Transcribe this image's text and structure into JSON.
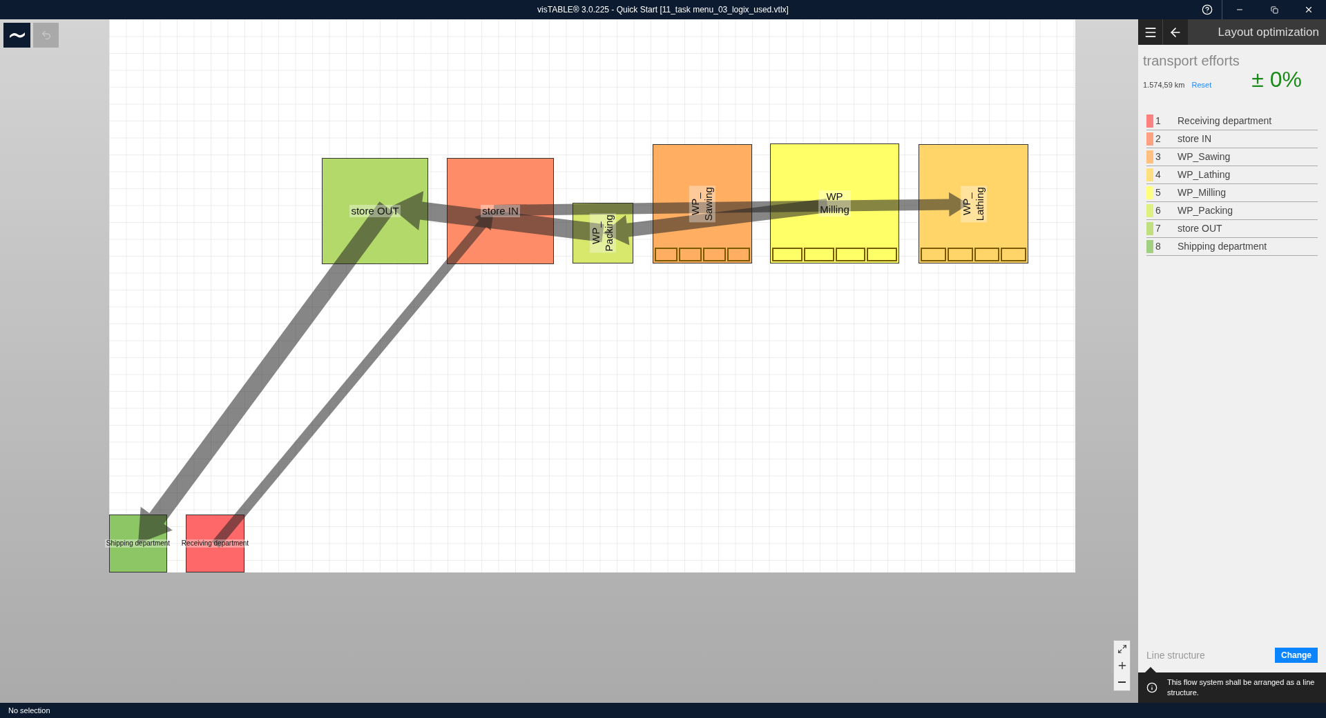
{
  "window": {
    "title": "visTABLE®  3.0.225 - Quick Start [11_task menu_03_logix_used.vtlx]"
  },
  "layout": {
    "areas": [
      {
        "label_lines": [
          "store OUT"
        ],
        "rotated": false,
        "color": "#b3d96a",
        "has_stations": false
      },
      {
        "label_lines": [
          "store IN"
        ],
        "rotated": false,
        "color": "#ff8c68",
        "has_stations": false
      },
      {
        "label_lines": [
          "WP_",
          "Packing"
        ],
        "rotated": true,
        "color": "#d8e86c",
        "has_stations": false
      },
      {
        "label_lines": [
          "WP_",
          "Sawing"
        ],
        "rotated": true,
        "color": "#ffae62",
        "has_stations": true
      },
      {
        "label_lines": [
          "WP",
          "Milling"
        ],
        "rotated": false,
        "color": "#ffff68",
        "has_stations": true
      },
      {
        "label_lines": [
          "WP_",
          "Lathing"
        ],
        "rotated": true,
        "color": "#ffd468",
        "has_stations": true
      },
      {
        "label_lines": [
          "Shipping department"
        ],
        "rotated": false,
        "color": "#8cc665",
        "has_stations": false
      },
      {
        "label_lines": [
          "Receiving department"
        ],
        "rotated": false,
        "color": "#ff6868",
        "has_stations": false
      }
    ]
  },
  "panel": {
    "title": "Layout optimization",
    "section": "transport efforts",
    "distance": "1.574,59 km",
    "reset": "Reset",
    "change": "± 0%",
    "legend": [
      {
        "number": "1",
        "name": "Receiving department",
        "color": "#ff8080"
      },
      {
        "number": "2",
        "name": "store IN",
        "color": "#ffa080"
      },
      {
        "number": "3",
        "name": "WP_Sawing",
        "color": "#ffc080"
      },
      {
        "number": "4",
        "name": "WP_Lathing",
        "color": "#ffe080"
      },
      {
        "number": "5",
        "name": "WP_Milling",
        "color": "#ffff80"
      },
      {
        "number": "6",
        "name": "WP_Packing",
        "color": "#e0f080"
      },
      {
        "number": "7",
        "name": "store OUT",
        "color": "#c0e080"
      },
      {
        "number": "8",
        "name": "Shipping department",
        "color": "#a0d080"
      }
    ],
    "structure_label": "Line structure",
    "change_button": "Change",
    "info": "This flow system shall be arranged as a line structure."
  },
  "status_bar": {
    "text": "No selection"
  }
}
